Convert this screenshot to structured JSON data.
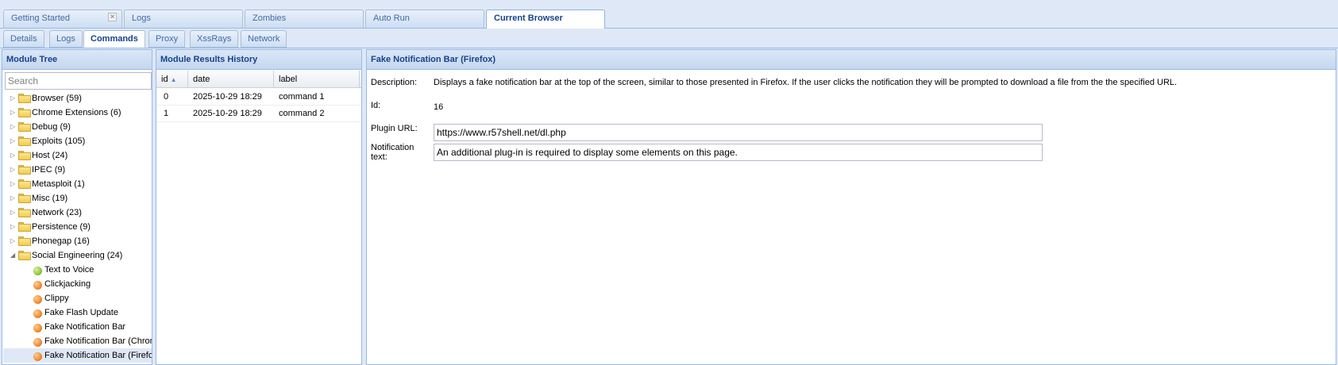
{
  "main_tabs": [
    {
      "label": "Getting Started",
      "closable": true
    },
    {
      "label": "Logs"
    },
    {
      "label": "Zombies"
    },
    {
      "label": "Auto Run"
    },
    {
      "label": "Current Browser",
      "active": true
    }
  ],
  "sub_tabs": [
    {
      "label": "Details"
    },
    {
      "label": "Logs"
    },
    {
      "label": "Commands",
      "active": true
    },
    {
      "label": "Proxy"
    },
    {
      "label": "XssRays"
    },
    {
      "label": "Network"
    }
  ],
  "module_tree": {
    "title": "Module Tree",
    "search_placeholder": "Search",
    "folders": [
      {
        "label": "Browser (59)"
      },
      {
        "label": "Chrome Extensions (6)"
      },
      {
        "label": "Debug (9)"
      },
      {
        "label": "Exploits (105)"
      },
      {
        "label": "Host (24)"
      },
      {
        "label": "IPEC (9)"
      },
      {
        "label": "Metasploit (1)"
      },
      {
        "label": "Misc (19)"
      },
      {
        "label": "Network (23)"
      },
      {
        "label": "Persistence (9)"
      },
      {
        "label": "Phonegap (16)"
      },
      {
        "label": "Social Engineering (24)",
        "expanded": true
      }
    ],
    "children": [
      {
        "label": "Text to Voice",
        "status": "green"
      },
      {
        "label": "Clickjacking",
        "status": "orange"
      },
      {
        "label": "Clippy",
        "status": "orange"
      },
      {
        "label": "Fake Flash Update",
        "status": "orange"
      },
      {
        "label": "Fake Notification Bar",
        "status": "orange"
      },
      {
        "label": "Fake Notification Bar (Chrome)",
        "status": "orange"
      },
      {
        "label": "Fake Notification Bar (Firefox)",
        "status": "orange",
        "selected": true
      }
    ]
  },
  "results": {
    "title": "Module Results History",
    "columns": [
      "id",
      "date",
      "label"
    ],
    "rows": [
      {
        "id": "0",
        "date": "2025-10-29 18:29",
        "label": "command 1"
      },
      {
        "id": "1",
        "date": "2025-10-29 18:29",
        "label": "command 2"
      }
    ]
  },
  "module": {
    "title": "Fake Notification Bar (Firefox)",
    "description_label": "Description:",
    "description": "Displays a fake notification bar at the top of the screen, similar to those presented in Firefox. If the user clicks the notification they will be prompted to download a file from the the specified URL.",
    "id_label": "Id:",
    "id": "16",
    "plugin_url_label": "Plugin URL:",
    "plugin_url": "https://www.r57shell.net/dl.php",
    "notification_text_label_1": "Notification",
    "notification_text_label_2": "text:",
    "notification_text": "An additional plug-in is required to display some elements on this page."
  }
}
